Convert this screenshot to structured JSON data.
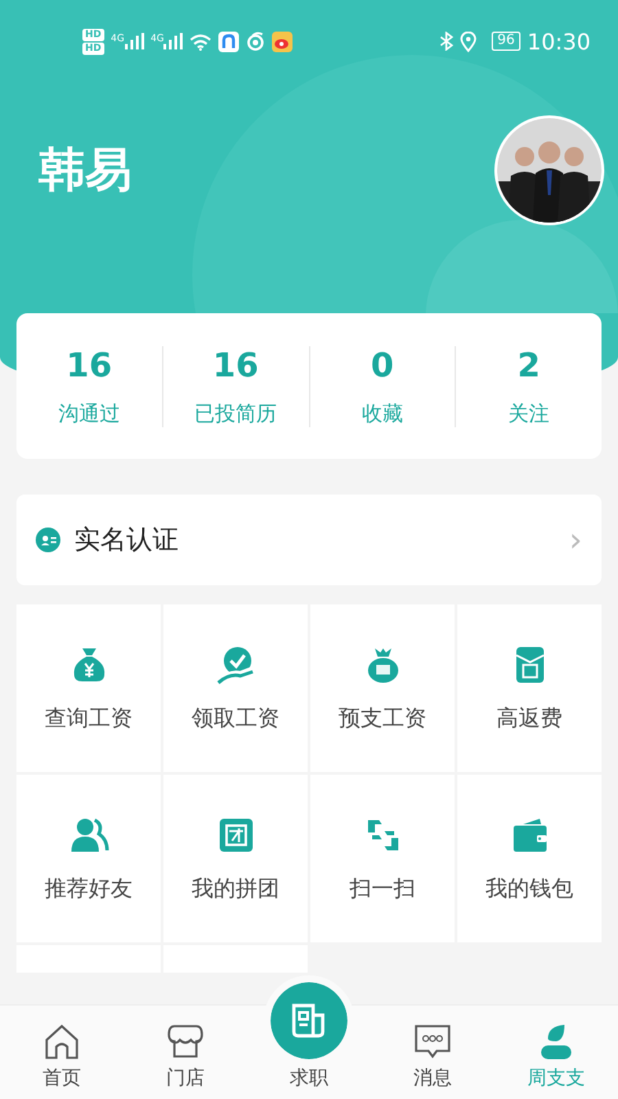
{
  "status_bar": {
    "sim_badges": [
      "HD",
      "HD"
    ],
    "networks": [
      "4G",
      "4G"
    ],
    "battery": "96",
    "time": "10:30"
  },
  "profile": {
    "name": "韩易"
  },
  "stats": [
    {
      "value": "16",
      "label": "沟通过"
    },
    {
      "value": "16",
      "label": "已投简历"
    },
    {
      "value": "0",
      "label": "收藏"
    },
    {
      "value": "2",
      "label": "关注"
    }
  ],
  "verify": {
    "label": "实名认证",
    "chevron": "›"
  },
  "services": [
    {
      "label": "查询工资",
      "kind": "moneybag"
    },
    {
      "label": "领取工资",
      "kind": "receive"
    },
    {
      "label": "预支工资",
      "kind": "advance"
    },
    {
      "label": "高返费",
      "kind": "envelope"
    },
    {
      "label": "推荐好友",
      "kind": "friends"
    },
    {
      "label": "我的拼团",
      "kind": "group"
    },
    {
      "label": "扫一扫",
      "kind": "scan"
    },
    {
      "label": "我的钱包",
      "kind": "wallet"
    },
    {
      "kind": "partial"
    },
    {
      "kind": "partial"
    }
  ],
  "tabs": [
    {
      "label": "首页",
      "kind": "home",
      "selected": false
    },
    {
      "label": "门店",
      "kind": "store",
      "selected": false
    },
    {
      "label": "求职",
      "kind": "center",
      "selected": false
    },
    {
      "label": "消息",
      "kind": "message",
      "selected": false
    },
    {
      "label": "周支支",
      "kind": "person",
      "selected": true
    }
  ]
}
